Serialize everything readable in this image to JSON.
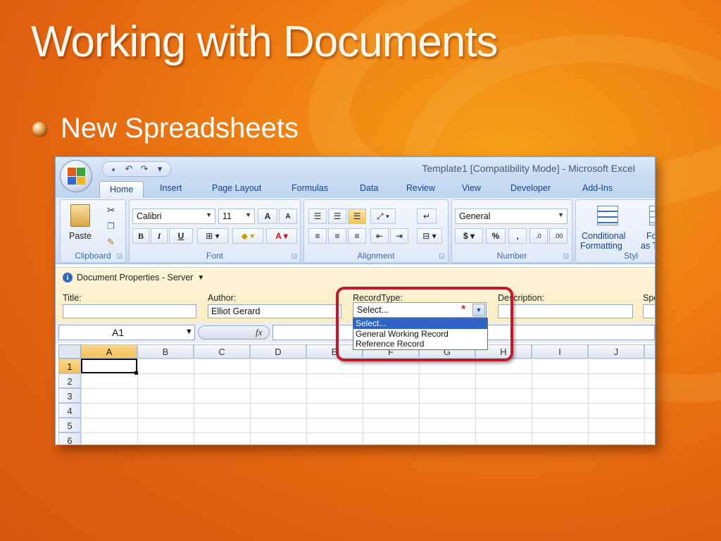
{
  "slide": {
    "title": "Working with Documents",
    "bullet": "New Spreadsheets"
  },
  "excel": {
    "window_title": "Template1  [Compatibility Mode] - Microsoft Excel",
    "qat": {
      "save": "▪",
      "undo": "↶",
      "redo": "↷",
      "customize": "▾"
    },
    "tabs": [
      "Home",
      "Insert",
      "Page Layout",
      "Formulas",
      "Data",
      "Review",
      "View",
      "Developer",
      "Add-Ins"
    ],
    "ribbon": {
      "clipboard": {
        "label": "Clipboard",
        "paste": "Paste"
      },
      "font": {
        "label": "Font",
        "family": "Calibri",
        "size": "11",
        "grow": "A",
        "shrink": "A",
        "bold": "B",
        "italic": "I",
        "underline": "U"
      },
      "alignment": {
        "label": "Alignment"
      },
      "number": {
        "label": "Number",
        "format": "General",
        "currency": "$",
        "percent": "%",
        "comma": ",",
        "inc_decimal": ".0",
        "dec_decimal": ".00"
      },
      "styles": {
        "label": "Styl",
        "conditional_line1": "Conditional",
        "conditional_line2": "Formatting",
        "format_line1": "Fo",
        "format_line2": "as T"
      }
    },
    "doc_props": {
      "header": "Document Properties - Server",
      "title_label": "Title:",
      "author_label": "Author:",
      "author_value": "Elliot Gerard",
      "recordtype_label": "RecordType:",
      "recordtype_value": "Select...",
      "description_label": "Description:",
      "spe_label": "Spe",
      "options": [
        "Select...",
        "General Working Record",
        "Reference Record"
      ]
    },
    "formula_bar": {
      "name_box": "A1",
      "fx": "fx"
    },
    "grid": {
      "columns": [
        "A",
        "B",
        "C",
        "D",
        "E",
        "F",
        "G",
        "H",
        "I",
        "J"
      ],
      "rows": [
        "1",
        "2",
        "3",
        "4",
        "5",
        "6"
      ]
    }
  }
}
